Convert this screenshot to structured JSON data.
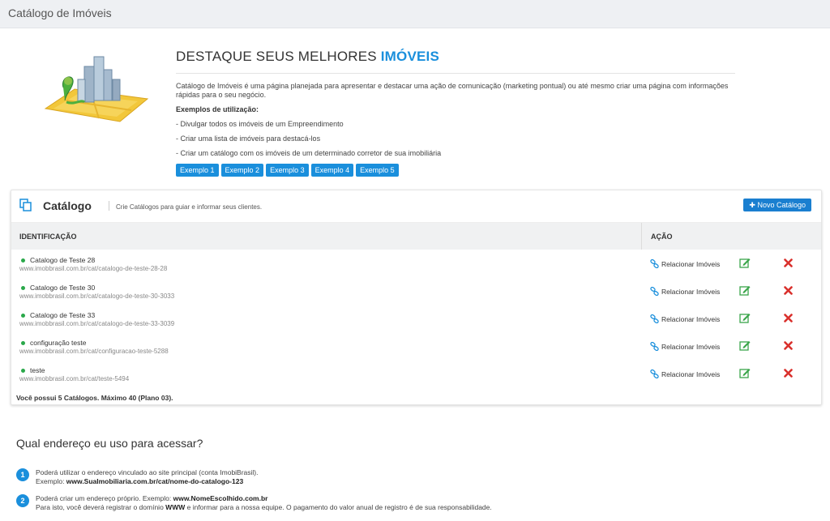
{
  "app": {
    "title": "Catálogo de Imóveis"
  },
  "hero": {
    "heading_plain": "DESTAQUE SEUS MELHORES ",
    "heading_highlight": "IMÓVEIS",
    "description": "Catálogo de Imóveis é uma página planejada para apresentar e destacar uma ação de comunicação (marketing pontual) ou até mesmo criar uma página com informações rápidas para o seu negócio.",
    "examples_title": "Exemplos de utilização:",
    "uses": [
      "- Divulgar todos os imóveis de um Empreendimento",
      "- Criar uma lista de imóveis para destacá-los",
      "- Criar um catálogo com os imóveis de um determinado corretor de sua imobiliária"
    ],
    "example_buttons": [
      "Exemplo 1",
      "Exemplo 2",
      "Exemplo 3",
      "Exemplo 4",
      "Exemplo 5"
    ]
  },
  "catalog": {
    "title": "Catálogo",
    "subtitle": "Crie Catálogos para guiar e informar seus clientes.",
    "new_button": "Novo Catálogo",
    "columns": {
      "identification": "IDENTIFICAÇÃO",
      "action": "AÇÃO"
    },
    "relate_label": "Relacionar Imóveis",
    "rows": [
      {
        "name": "Catalogo de Teste 28",
        "url": "www.imobbrasil.com.br/cat/catalogo-de-teste-28-28"
      },
      {
        "name": "Catalogo de Teste 30",
        "url": "www.imobbrasil.com.br/cat/catalogo-de-teste-30-3033"
      },
      {
        "name": "Catalogo de Teste 33",
        "url": "www.imobbrasil.com.br/cat/catalogo-de-teste-33-3039"
      },
      {
        "name": "configuração teste",
        "url": "www.imobbrasil.com.br/cat/configuracao-teste-5288"
      },
      {
        "name": "teste",
        "url": "www.imobbrasil.com.br/cat/teste-5494"
      }
    ],
    "summary": "Você possui 5 Catálogos. Máximo 40 (Plano 03)."
  },
  "address": {
    "title": "Qual endereço eu uso para acessar?",
    "steps": [
      {
        "num": "1",
        "line1": "Poderá utilizar o endereço vinculado ao site principal (conta ImobiBrasil).",
        "line2_prefix": "Exemplo: ",
        "line2_bold": "www.SuaImobiliaria.com.br/cat/nome-do-catalogo-123"
      },
      {
        "num": "2",
        "line1_prefix": "Poderá criar um endereço próprio. Exemplo: ",
        "line1_bold": "www.NomeEscolhido.com.br",
        "line2_prefix": "Para isto, você deverá registrar o domínio ",
        "line2_bold": "WWW",
        "line2_suffix": " e informar para a nossa equipe. O pagamento do valor anual de registro é de sua responsabilidade."
      }
    ]
  },
  "colors": {
    "accent": "#1a8fdc",
    "active_dot": "#2aa84a",
    "delete": "#d9302c",
    "edit": "#3aa54a"
  }
}
